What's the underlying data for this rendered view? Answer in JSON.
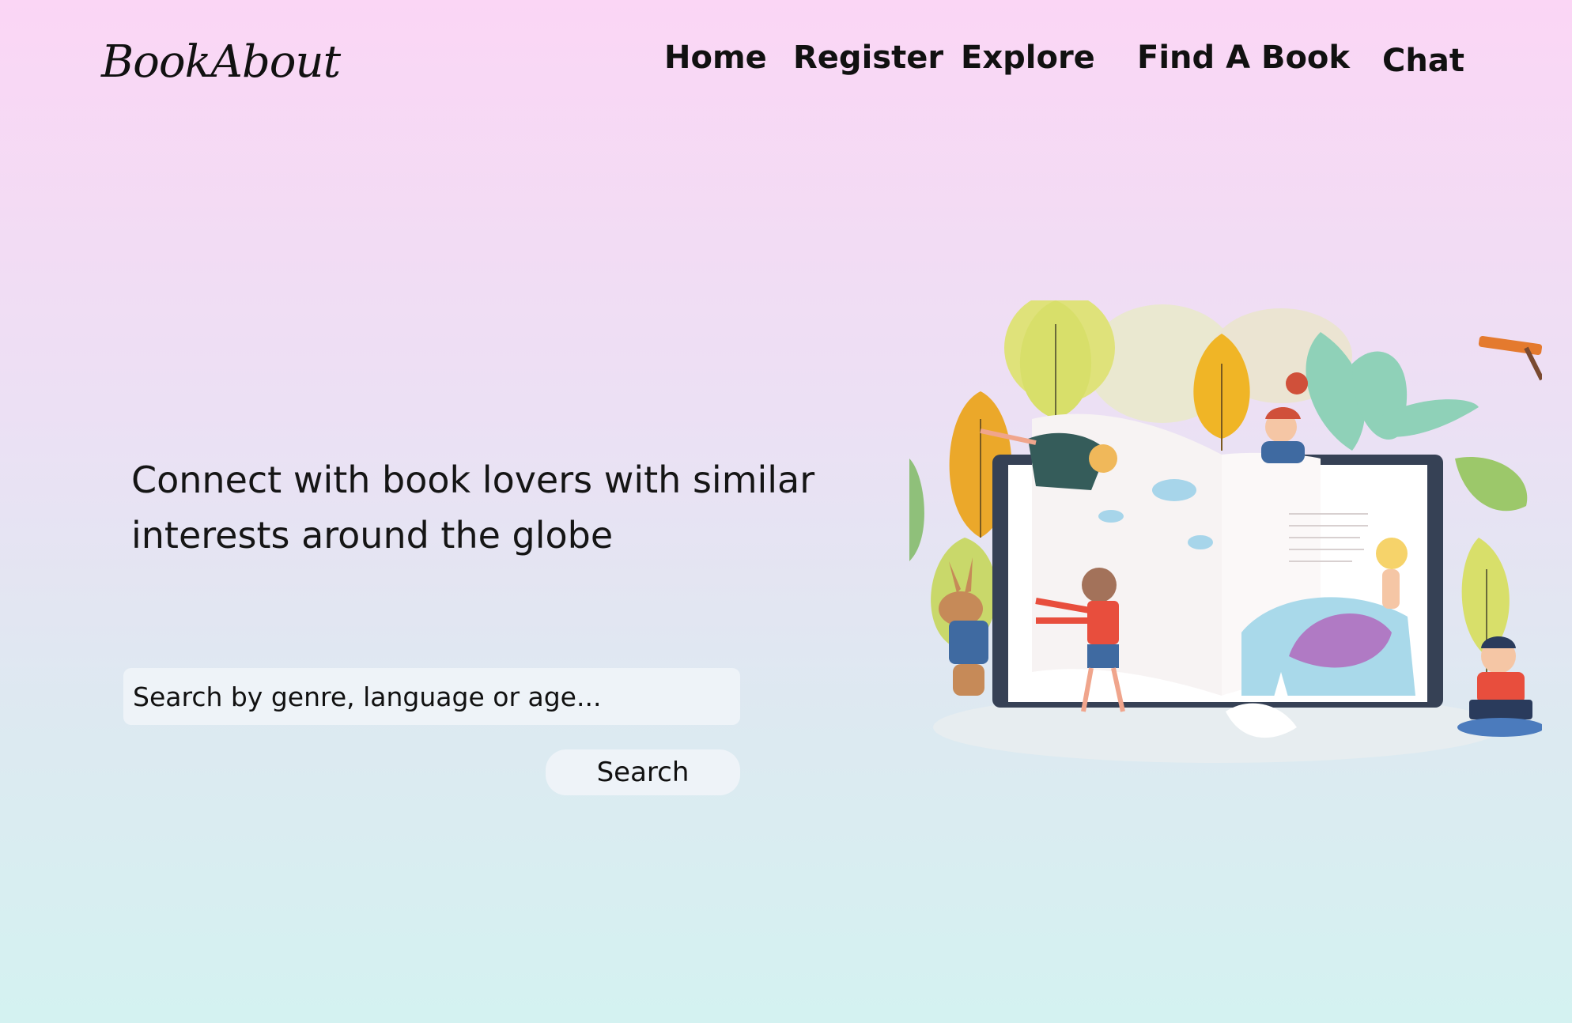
{
  "brand": {
    "logo_text": "BookAbout"
  },
  "nav": {
    "items": [
      {
        "label": "Home"
      },
      {
        "label": "Register"
      },
      {
        "label": "Explore"
      },
      {
        "label": "Find A Book"
      },
      {
        "label": "Chat"
      }
    ]
  },
  "hero": {
    "line1": "Connect with book lovers with similar",
    "line2": "interests around the globe"
  },
  "search": {
    "placeholder": "Search by genre, language or age...",
    "value": "",
    "button_label": "Search"
  },
  "colors": {
    "bg_top": "#fbd6f5",
    "bg_bottom": "#d4f2f1",
    "input_bg": "#eef3f8",
    "book_frame": "#364155"
  }
}
